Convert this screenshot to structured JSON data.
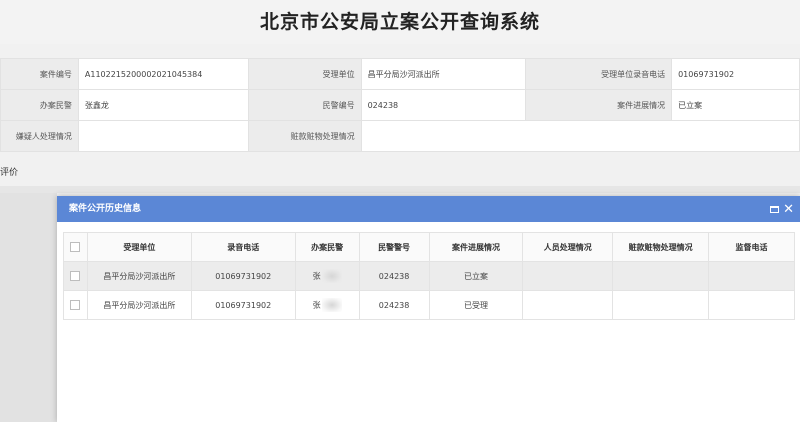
{
  "page": {
    "title": "北京市公安局立案公开查询系统"
  },
  "case_info": {
    "rows": [
      [
        {
          "label": "案件编号",
          "value": "A1102215200002021045384"
        },
        {
          "label": "受理单位",
          "value": "昌平分局沙河派出所"
        },
        {
          "label": "受理单位录音电话",
          "value": "01069731902"
        }
      ],
      [
        {
          "label": "办案民警",
          "value": "张鑫龙"
        },
        {
          "label": "民警编号",
          "value": "024238"
        },
        {
          "label": "案件进展情况",
          "value": "已立案"
        }
      ],
      [
        {
          "label": "嫌疑人处理情况",
          "value": ""
        },
        {
          "label": "赃款赃物处理情况",
          "value": ""
        }
      ]
    ]
  },
  "section": {
    "evaluation_label": "评价"
  },
  "modal": {
    "title": "案件公开历史信息",
    "columns": [
      "受理单位",
      "录音电话",
      "办案民警",
      "民警警号",
      "案件进展情况",
      "人员处理情况",
      "赃款赃物处理情况",
      "监督电话"
    ],
    "rows": [
      {
        "unit": "昌平分局沙河派出所",
        "phone": "01069731902",
        "officer": "张",
        "badge": "024238",
        "progress": "已立案",
        "person_handling": "",
        "stolen_goods": "",
        "supervision_phone": ""
      },
      {
        "unit": "昌平分局沙河派出所",
        "phone": "01069731902",
        "officer": "张",
        "badge": "024238",
        "progress": "已受理",
        "person_handling": "",
        "stolen_goods": "",
        "supervision_phone": ""
      }
    ]
  },
  "colors": {
    "modal_header": "#5b87d6",
    "label_bg": "#ececec"
  },
  "icons": {
    "restore": "window-restore-icon",
    "close": "close-icon"
  }
}
